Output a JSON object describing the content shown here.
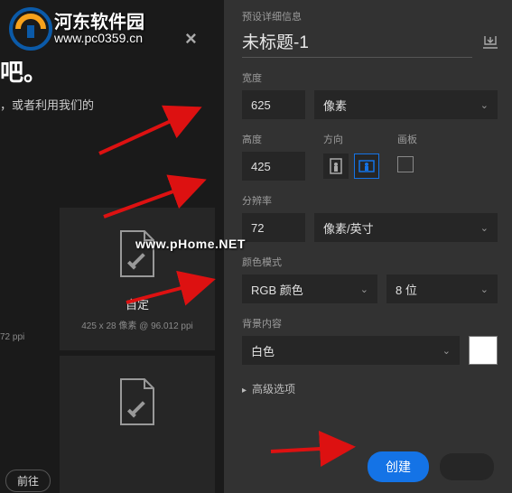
{
  "watermark": {
    "site_name": "河东软件园",
    "site_url": "www.pc0359.cn",
    "center": "www.pHome.NET"
  },
  "left": {
    "close": "×",
    "heading": "吧。",
    "subtext": "，或者利用我们的",
    "tile1_label": "自定",
    "tile1_meta": "425 x 28 像素 @ 96.012 ppi",
    "meta_left": "72 ppi",
    "goto": "前往"
  },
  "right": {
    "preset_info": "预设详细信息",
    "title": "未标题-1",
    "width_label": "宽度",
    "width_value": "625",
    "width_unit": "像素",
    "height_label": "高度",
    "height_value": "425",
    "orient_label": "方向",
    "artboard_label": "画板",
    "res_label": "分辨率",
    "res_value": "72",
    "res_unit": "像素/英寸",
    "colormode_label": "颜色模式",
    "colormode_value": "RGB 颜色",
    "colordepth_value": "8 位",
    "bg_label": "背景内容",
    "bg_value": "白色",
    "adv": "高级选项",
    "create": "创建"
  }
}
